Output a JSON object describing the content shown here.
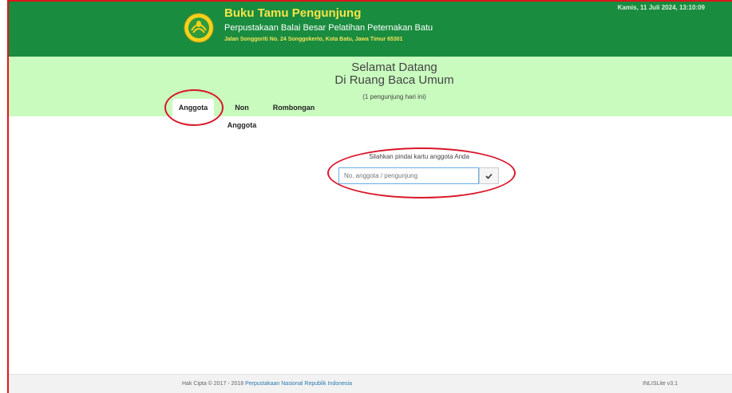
{
  "header": {
    "title": "Buku Tamu Pengunjung",
    "subtitle": "Perpustakaan Balai Besar Pelatihan Peternakan Batu",
    "address": "Jalan Songgoriti No. 24 Songgokerto, Kota Batu, Jawa Timur 65301",
    "datetime": "Kamis, 11 Juli 2024, 13:10:09",
    "logo_icon": "ministry-emblem-icon"
  },
  "banner": {
    "welcome_line1": "Selamat Datang",
    "welcome_line2": "Di Ruang Baca Umum",
    "visitor_count": "(1 pengunjung hari ini)"
  },
  "tabs": [
    {
      "label": "Anggota",
      "active": true
    },
    {
      "label": "Non Anggota",
      "active": false
    },
    {
      "label": "Rombongan",
      "active": false
    }
  ],
  "scan": {
    "label": "Silahkan pindai kartu anggota Anda",
    "placeholder": "No. anggota / pengunjung",
    "submit_icon": "check-icon"
  },
  "footer": {
    "copyright_prefix": "Hak Cipta © 2017 - 2018",
    "copyright_link": "Perpustakaan Nasional Republik Indonesia",
    "version": "INLISLite v3.1"
  },
  "colors": {
    "header_bg": "#1a8c3f",
    "banner_bg": "#c9fbbf",
    "title": "#f5e44a",
    "annotation": "#d9162a"
  }
}
